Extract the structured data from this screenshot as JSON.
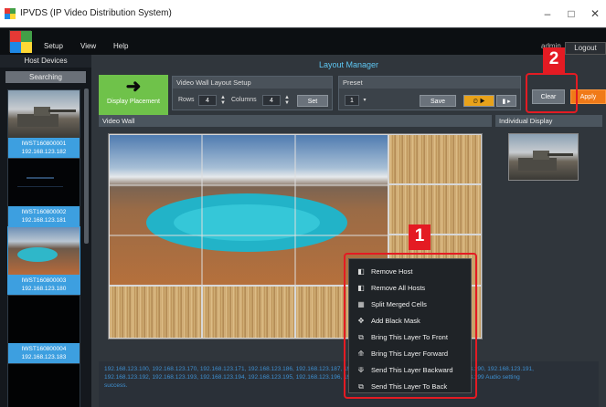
{
  "window": {
    "title": "IPVDS (IP Video Distribution System)",
    "min": "–",
    "max": "□",
    "close": "✕"
  },
  "menu": {
    "setup": "Setup",
    "view": "View",
    "help": "Help",
    "admin": "admin",
    "logout": "Logout"
  },
  "sidebar": {
    "header": "Host Devices",
    "searching": "Searching",
    "devices": [
      {
        "name": "IWST160800001",
        "ip": "192.168.123.182"
      },
      {
        "name": "IWST160800002",
        "ip": "192.168.123.181"
      },
      {
        "name": "IWST160800003",
        "ip": "192.168.123.180"
      },
      {
        "name": "IWST160800004",
        "ip": "192.168.123.183"
      }
    ]
  },
  "layout": {
    "title": "Layout Manager",
    "placement_label": "Display Placement",
    "placement_icon": "arrow-right-icon",
    "wall_setup": {
      "title": "Video Wall Layout Setup",
      "rows_label": "Rows",
      "rows": "4",
      "cols_label": "Columns",
      "cols": "4",
      "set": "Set"
    },
    "preset": {
      "title": "Preset",
      "value": "1",
      "save": "Save"
    },
    "clear": "Clear",
    "apply": "Apply",
    "video_wall": "Video Wall",
    "individual": "Individual Display"
  },
  "context_menu": [
    {
      "icon": "remove-host-icon",
      "label": "Remove Host"
    },
    {
      "icon": "remove-all-hosts-icon",
      "label": "Remove All Hosts"
    },
    {
      "icon": "split-cells-icon",
      "label": "Split Merged Cells"
    },
    {
      "icon": "black-mask-icon",
      "label": "Add Black Mask"
    },
    {
      "icon": "bring-front-icon",
      "label": "Bring This Layer To Front"
    },
    {
      "icon": "bring-forward-icon",
      "label": "Bring This Layer Forward"
    },
    {
      "icon": "send-backward-icon",
      "label": "Send This Layer Backward"
    },
    {
      "icon": "send-back-icon",
      "label": "Send This Layer To Back"
    }
  ],
  "log": {
    "line1": "192.168.123.100, 192.168.123.170, 192.168.123.171, 192.168.123.186, 192.168.123.187, 192.168.123.188, 192.168.123.189, 192.168.123.190, 192.168.123.191,",
    "line2": "192.168.123.192, 192.168.123.193, 192.168.123.194, 192.168.123.195, 192.168.123.196, 192.168.123.197, 192.168.123.198, 192.168.123.199 Audio setting",
    "line3": "success."
  },
  "annotations": {
    "one": "1",
    "two": "2"
  },
  "colors": {
    "accent_green": "#6fc24a",
    "highlight_red": "#e41b23",
    "apply_orange": "#f07a18",
    "label_blue": "#3d9fe0"
  }
}
